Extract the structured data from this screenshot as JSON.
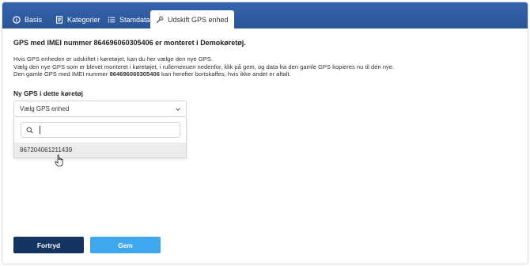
{
  "tabs": [
    {
      "label": "Basis",
      "icon": "info-icon",
      "active": false
    },
    {
      "label": "Kategorier",
      "icon": "document-icon",
      "active": false
    },
    {
      "label": "Stamdata",
      "icon": "list-icon",
      "active": false
    },
    {
      "label": "Udskift GPS enhed",
      "icon": "wrench-icon",
      "active": true
    }
  ],
  "headline": {
    "prefix": "GPS med IMEI nummer",
    "imei": "864696060305406",
    "middle": "er monteret i",
    "vehicle": "Demokøretøj",
    "suffix": "."
  },
  "info": {
    "line1": "Hvis GPS enheden er udskiftet i køretøjet, kan du her vælge den nye GPS.",
    "line2": "Vælg den nye GPS som er blevet monteret i køretøjet, i rullemenuen nedenfor, klik på gem, og data fra den gamle GPS kopieres nu til den nye.",
    "line3_prefix": "Den gamle GPS med IMEI nummer",
    "line3_imei": "864696060305406",
    "line3_suffix": "kan herefter bortskaffes, hvis ikke andet er aftalt."
  },
  "section_title": "Ny GPS i dette køretøj",
  "select": {
    "placeholder": "Vælg GPS enhed",
    "search_value": "",
    "options": [
      "867204061211439"
    ]
  },
  "buttons": {
    "cancel": "Fortryd",
    "save": "Gem"
  },
  "colors": {
    "tabbar": "#2f5aa0",
    "cancel_button": "#143561",
    "save_button": "#3fa7ee",
    "highlighted_option": "#ececec"
  }
}
